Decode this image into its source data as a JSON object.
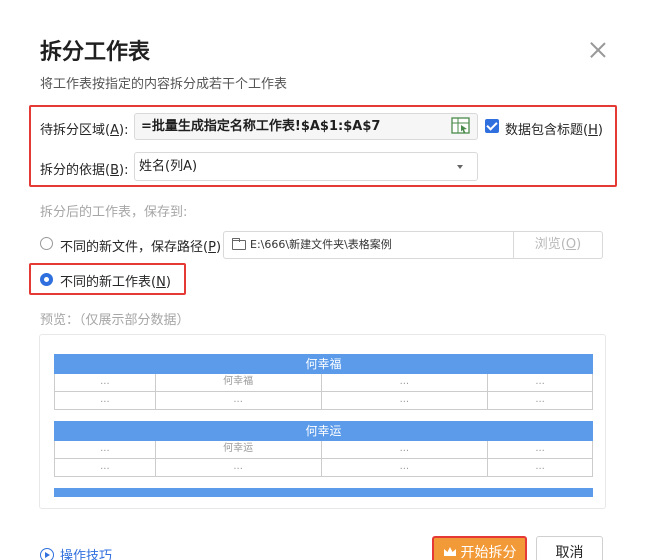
{
  "dialog": {
    "title": "拆分工作表",
    "subtitle": "将工作表按指定的内容拆分成若干个工作表"
  },
  "split_range": {
    "label": "待拆分区域",
    "hotkey": "A",
    "value": "=批量生成指定名称工作表!$A$1:$A$7"
  },
  "header_option": {
    "label": "数据包含标题",
    "hotkey": "H",
    "checked": true
  },
  "split_basis": {
    "label": "拆分的依据",
    "hotkey": "B",
    "selected": "姓名(列A)"
  },
  "save_to": {
    "label": "拆分后的工作表，保存到:",
    "option_files": {
      "label": "不同的新文件，保存路径",
      "hotkey": "P",
      "selected": false
    },
    "path_value": "E:\\666\\新建文件夹\\表格案例",
    "browse": {
      "label": "浏览",
      "hotkey": "O"
    },
    "option_sheets": {
      "label": "不同的新工作表",
      "hotkey": "N",
      "selected": true
    }
  },
  "preview": {
    "label": "预览：（仅展示部分数据）",
    "tables": [
      {
        "header": "何幸福",
        "row1": [
          "...",
          "何幸福",
          "...",
          "..."
        ],
        "row2": [
          "...",
          "...",
          "...",
          "..."
        ]
      },
      {
        "header": "何幸运",
        "row1": [
          "...",
          "何幸运",
          "...",
          "..."
        ],
        "row2": [
          "...",
          "...",
          "...",
          "..."
        ]
      }
    ]
  },
  "footer": {
    "tips_label": "操作技巧",
    "start_label": "开始拆分",
    "cancel_label": "取消"
  },
  "colors": {
    "accent": "#2f6fde",
    "highlight_border": "#e53935",
    "start_button": "#f29a38",
    "preview_header": "#5b9bea"
  }
}
